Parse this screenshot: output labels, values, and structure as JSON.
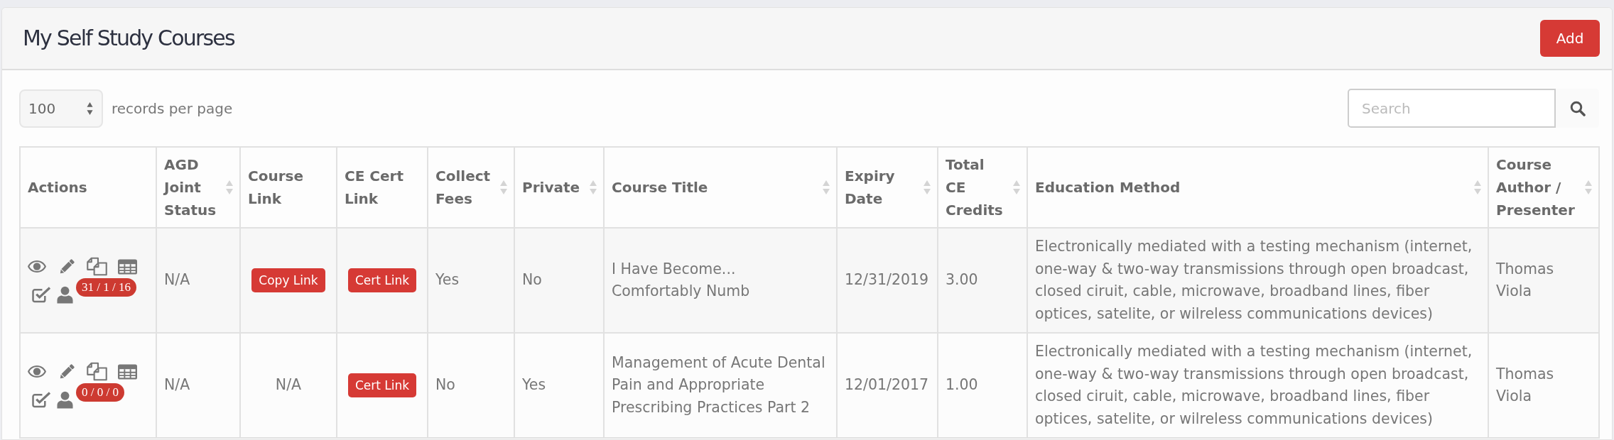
{
  "header": {
    "title": "My Self Study Courses",
    "add_button": "Add"
  },
  "table_controls": {
    "page_size": "100",
    "page_size_label": "records per page",
    "search": {
      "placeholder": "Search"
    }
  },
  "table": {
    "columns": [
      {
        "label": "Actions",
        "sortable": false
      },
      {
        "label": "AGD Joint Status",
        "sortable": true
      },
      {
        "label": "Course Link",
        "sortable": false
      },
      {
        "label": "CE Cert Link",
        "sortable": false
      },
      {
        "label": "Collect Fees",
        "sortable": true
      },
      {
        "label": "Private",
        "sortable": true
      },
      {
        "label": "Course Title",
        "sortable": true
      },
      {
        "label": "Expiry Date",
        "sortable": true
      },
      {
        "label": "Total CE Credits",
        "sortable": true
      },
      {
        "label": "Education Method",
        "sortable": true
      },
      {
        "label": "Course Author / Presenter",
        "sortable": true
      }
    ],
    "rows": [
      {
        "actions_badge": "31 / 1 / 16",
        "agd_joint_status": "N/A",
        "course_link": {
          "kind": "button",
          "text": "Copy Link"
        },
        "ce_cert_link": {
          "kind": "button",
          "text": "Cert Link"
        },
        "collect_fees": "Yes",
        "private": "No",
        "course_title": "I Have Become...\nComfortably Numb",
        "expiry_date": "12/31/2019",
        "total_ce_credits": "3.00",
        "education_method": "Electronically mediated with a testing mechanism (internet, one-way & two-way transmissions through open broadcast, closed ciruit, cable, microwave, broadband lines, fiber optices, satelite, or wilreless communications devices)",
        "course_author": "Thomas Viola"
      },
      {
        "actions_badge": "0 / 0 / 0",
        "agd_joint_status": "N/A",
        "course_link": {
          "kind": "text",
          "text": "N/A"
        },
        "ce_cert_link": {
          "kind": "button",
          "text": "Cert Link"
        },
        "collect_fees": "No",
        "private": "Yes",
        "course_title": "Management of Acute Dental Pain and Appropriate Prescribing Practices Part 2",
        "expiry_date": "12/01/2017",
        "total_ce_credits": "1.00",
        "education_method": "Electronically mediated with a testing mechanism (internet, one-way & two-way transmissions through open broadcast, closed ciruit, cable, microwave, broadband lines, fiber optices, satelite, or wilreless communications devices)",
        "course_author": "Thomas Viola"
      }
    ]
  }
}
